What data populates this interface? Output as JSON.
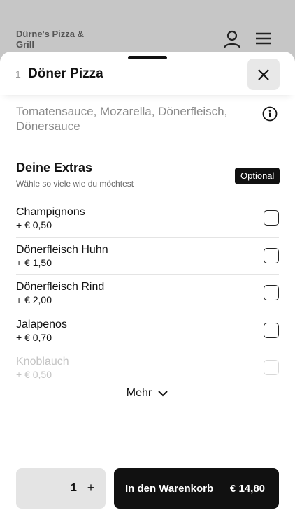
{
  "background": {
    "restaurant_name": "Dürne's Pizza & Grill",
    "icons": [
      "user-icon",
      "hamburger-menu-icon"
    ]
  },
  "modal": {
    "quantity_prefix": "1",
    "item_title": "Döner Pizza",
    "description": "Tomatensauce, Mozarella, Dönerfleisch, Dönersauce",
    "extras": {
      "title": "Deine Extras",
      "subtitle": "Wähle so viele wie du möchtest",
      "badge": "Optional",
      "items": [
        {
          "name": "Champignons",
          "price": "+ € 0,50"
        },
        {
          "name": "Dönerfleisch Huhn",
          "price": "+ € 1,50"
        },
        {
          "name": "Dönerfleisch Rind",
          "price": "+ € 2,00"
        },
        {
          "name": "Jalapenos",
          "price": "+ € 0,70"
        },
        {
          "name": "Knoblauch",
          "price": "+ € 0,50"
        }
      ],
      "more_label": "Mehr"
    },
    "footer": {
      "quantity": "1",
      "plus_label": "+",
      "cart_label": "In den Warenkorb",
      "cart_price": "€ 14,80"
    }
  },
  "colors": {
    "accent": "#111111",
    "muted_text": "#8a8a8a",
    "overlay": "#c6c6c6",
    "control_bg": "#e4e4e4"
  }
}
